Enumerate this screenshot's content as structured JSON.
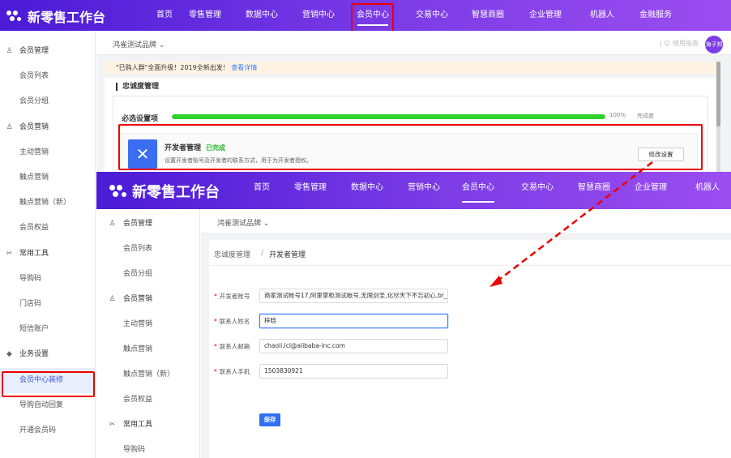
{
  "app": {
    "logo_text": "新零售工作台"
  },
  "nav": {
    "items": [
      "首页",
      "零售管理",
      "数据中心",
      "营销中心",
      "会员中心",
      "交易中心",
      "智慧商圈",
      "企业管理",
      "机器人",
      "金融服务"
    ],
    "active": "会员中心"
  },
  "nav2": {
    "items": [
      "首页",
      "零售管理",
      "数据中心",
      "营销中心",
      "会员中心",
      "交易中心",
      "智慧商圈",
      "企业管理",
      "机器人"
    ],
    "active": "会员中心"
  },
  "brand": "鸿雀测试品牌 ⌄",
  "avatar_text": "海子邦",
  "topright_text": "| ☺ 使用指南",
  "sidebar": {
    "items": [
      {
        "label": "会员管理",
        "type": "group",
        "icon": "user-icon"
      },
      {
        "label": "会员列表",
        "type": "sub"
      },
      {
        "label": "会员分组",
        "type": "sub"
      },
      {
        "label": "会员营销",
        "type": "group",
        "icon": "user-icon"
      },
      {
        "label": "主动营销",
        "type": "sub"
      },
      {
        "label": "触点营销",
        "type": "sub"
      },
      {
        "label": "触点营销（新）",
        "type": "sub"
      },
      {
        "label": "会员权益",
        "type": "sub"
      },
      {
        "label": "常用工具",
        "type": "group",
        "icon": "tools-icon"
      },
      {
        "label": "导购码",
        "type": "sub"
      },
      {
        "label": "门店码",
        "type": "sub"
      },
      {
        "label": "短信账户",
        "type": "sub"
      },
      {
        "label": "业务设置",
        "type": "group",
        "icon": "diamond-icon"
      },
      {
        "label": "会员中心装修",
        "type": "sub",
        "active": true
      },
      {
        "label": "导购自动回复",
        "type": "sub"
      },
      {
        "label": "开通会员码",
        "type": "sub"
      }
    ]
  },
  "sidebar2": {
    "items": [
      {
        "label": "会员管理",
        "type": "group",
        "icon": "user-icon"
      },
      {
        "label": "会员列表",
        "type": "sub"
      },
      {
        "label": "会员分组",
        "type": "sub"
      },
      {
        "label": "会员营销",
        "type": "group",
        "icon": "user-icon"
      },
      {
        "label": "主动营销",
        "type": "sub"
      },
      {
        "label": "触点营销",
        "type": "sub"
      },
      {
        "label": "触点营销（新）",
        "type": "sub"
      },
      {
        "label": "会员权益",
        "type": "sub"
      },
      {
        "label": "常用工具",
        "type": "group",
        "icon": "tools-icon"
      },
      {
        "label": "导购码",
        "type": "sub"
      }
    ]
  },
  "notice": {
    "text": "\"已购人群\"全面升级！2019全新出发！",
    "link": "查看详情"
  },
  "loyalty": {
    "title": "忠诚度管理",
    "required_label": "必选设置项",
    "progress": 100,
    "progress_text": "100%",
    "complete_label": "完成度",
    "developer": {
      "title": "开发者管理",
      "status": "已完成",
      "desc": "设置开发者账号及开发者的联系方式，用于为开发者授权。",
      "button": "修改设置"
    }
  },
  "breadcrumb": {
    "parent": "忠诚度管理",
    "sep": "/",
    "current": "开发者管理"
  },
  "form": {
    "fields": [
      {
        "label": "开发者账号",
        "value": "商家测试帐号17,阿里掌柜测试帐号,无限剑圣,化尽天下不忘初心,br_"
      },
      {
        "label": "联系人姓名",
        "value": "梓晗"
      },
      {
        "label": "联系人邮箱",
        "value": "chaoli.lcl@alibaba-inc.com"
      },
      {
        "label": "联系人手机",
        "value": "1503830921"
      }
    ],
    "save": "保存"
  },
  "colors": {
    "accent": "#3b7bff",
    "brand_gradient_start": "#4b1bd6",
    "brand_gradient_end": "#9b4df0",
    "annotation": "#e00000",
    "success": "#2ed12e"
  }
}
